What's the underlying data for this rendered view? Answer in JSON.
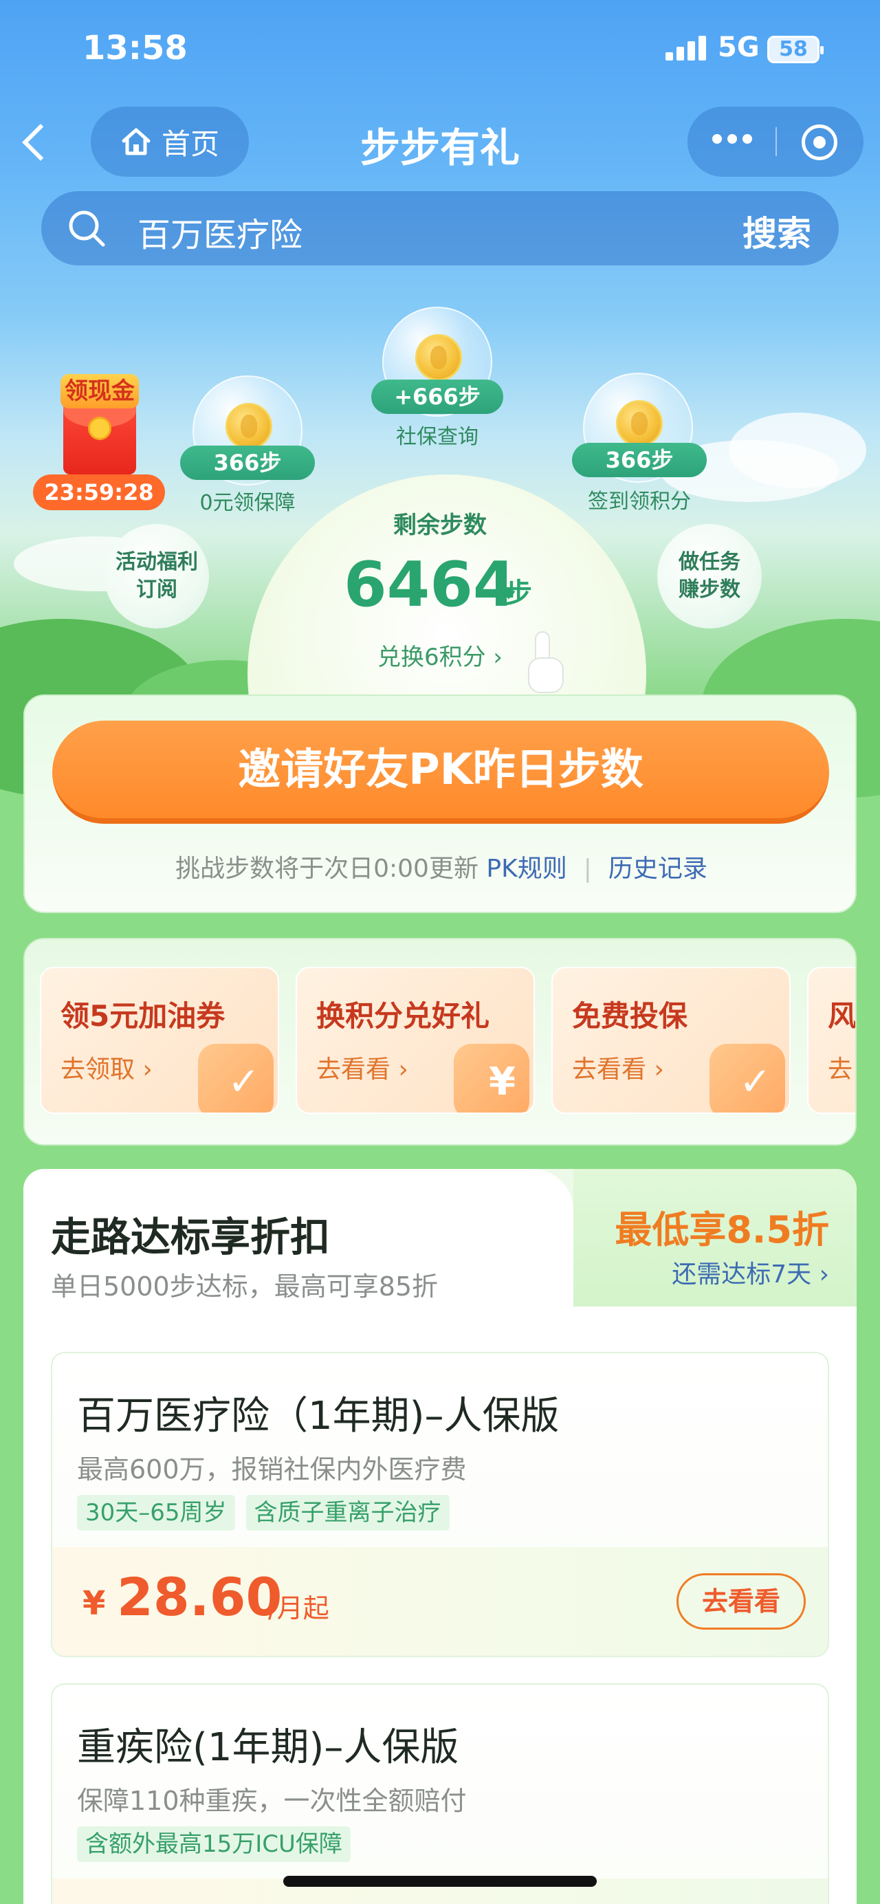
{
  "status_bar": {
    "time": "13:58",
    "network": "5G",
    "battery": "58"
  },
  "nav": {
    "home_label": "首页",
    "title": "步步有礼"
  },
  "search": {
    "placeholder": "百万医疗险",
    "button": "搜索"
  },
  "bubbles": [
    {
      "steps": "+666步",
      "label": "社保查询"
    },
    {
      "steps": "366步",
      "label": "0元领保障"
    },
    {
      "steps": "366步",
      "label": "签到领积分"
    }
  ],
  "side_bubbles": {
    "left": "活动福利\n订阅",
    "right": "做任务\n赚步数"
  },
  "red_packet": {
    "label": "领现金",
    "countdown": "23:59:28"
  },
  "steps": {
    "label": "剩余步数",
    "value": "6464",
    "unit": "步",
    "exchange": "兑换6积分 ›"
  },
  "pk": {
    "button": "邀请好友PK昨日步数",
    "info": "挑战步数将于次日0:00更新",
    "rules": "PK规则",
    "history": "历史记录"
  },
  "promos": [
    {
      "title": "领5元加油券",
      "link": "去领取 ›"
    },
    {
      "title": "换积分兑好礼",
      "link": "去看看 ›"
    },
    {
      "title": "免费投保",
      "link": "去看看 ›"
    },
    {
      "title": "风",
      "link": "去"
    }
  ],
  "discount": {
    "title": "走路达标享折扣",
    "subtitle": "单日5000步达标，最高可享85折",
    "rate": "最低享8.5折",
    "need": "还需达标7天 ›"
  },
  "products": [
    {
      "name": "百万医疗险（1年期)–人保版",
      "desc": "最高600万，报销社保内外医疗费",
      "tags": [
        "30天–65周岁",
        "含质子重离子治疗"
      ],
      "currency": "¥",
      "price": "28.60",
      "price_unit": "/月起",
      "button": "去看看"
    },
    {
      "name": "重疾险(1年期)–人保版",
      "desc": "保障110种重疾，一次性全额赔付",
      "tags": [
        "含额外最高15万ICU保障"
      ]
    }
  ]
}
